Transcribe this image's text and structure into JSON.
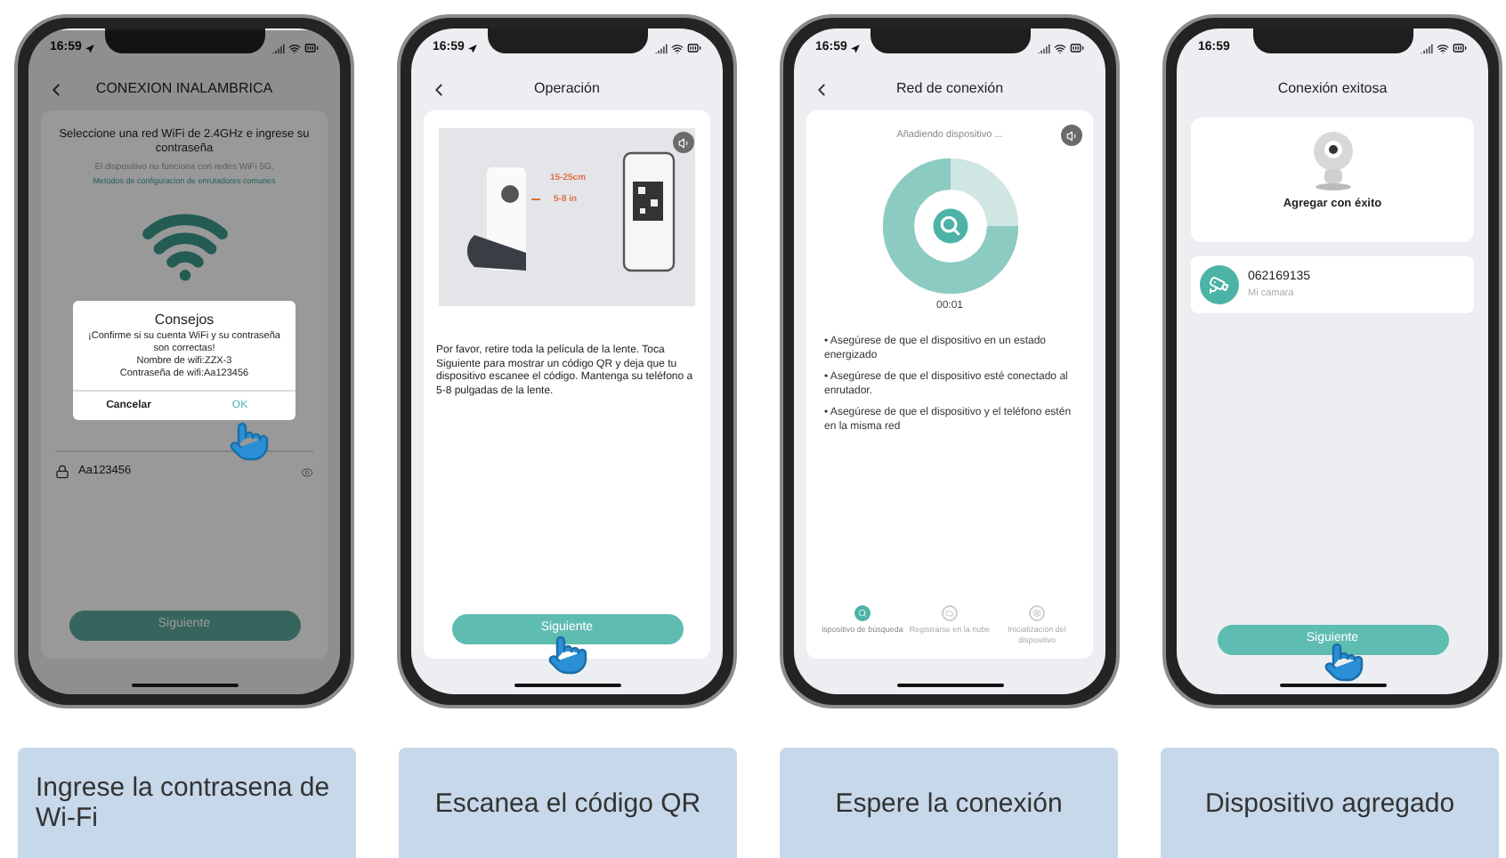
{
  "phones": [
    {
      "kind": "wifi",
      "time": "16:59",
      "title": "CONEXION INALAMBRICA",
      "heading": "Seleccione una red WiFi de 2.4GHz e ingrese su contraseña",
      "note": "El dispositivo no funciona con redes WiFi 5G.",
      "link": "Metodos de configuracion de enrutadores comunes",
      "password": "Aa123456",
      "button": "Siguiente",
      "dialog": {
        "title": "Consejos",
        "lines": [
          "¡Confirme si su cuenta WiFi y su contraseña son correctas!",
          "Nombre de wifi:ZZX-3",
          "Contraseña de wifi:Aa123456"
        ],
        "cancel": "Cancelar",
        "ok": "OK"
      }
    },
    {
      "kind": "qr",
      "time": "16:59",
      "title": "Operación",
      "distance": "15-25cm",
      "distance_in": "5-8 in",
      "text": "Por favor, retire toda la película de la lente. Toca Siguiente para mostrar un código QR y deja que tu dispositivo escanee el código. Mantenga su teléfono a 5-8 pulgadas de la lente.",
      "button": "Siguiente"
    },
    {
      "kind": "search",
      "time": "16:59",
      "title": "Red de conexión",
      "status": "Añadiendo dispositivo ...",
      "timer": "00:01",
      "tips": [
        "• Asegúrese de que el dispositivo en un estado energizado",
        "• Asegúrese de que el dispositivo esté conectado al enrutador.",
        "• Asegúrese de que el dispositivo y el teléfono estén en la misma red"
      ],
      "steps": [
        {
          "label": "ispositivo de búsqueda",
          "selected": true
        },
        {
          "label": "Registrarse en la nube",
          "selected": false
        },
        {
          "label": "Inicialización del dispositivo",
          "selected": false
        }
      ]
    },
    {
      "kind": "done",
      "time": "16:59",
      "title": "Conexión exitosa",
      "message": "Agregar con éxito",
      "device_id": "062169135",
      "device_name": "Mi camara",
      "button": "Siguiente"
    }
  ],
  "captions": [
    "Ingrese la contrasena de Wi-Fi",
    "Escanea el código QR",
    "Espere la conexión",
    "Dispositivo agregado"
  ]
}
